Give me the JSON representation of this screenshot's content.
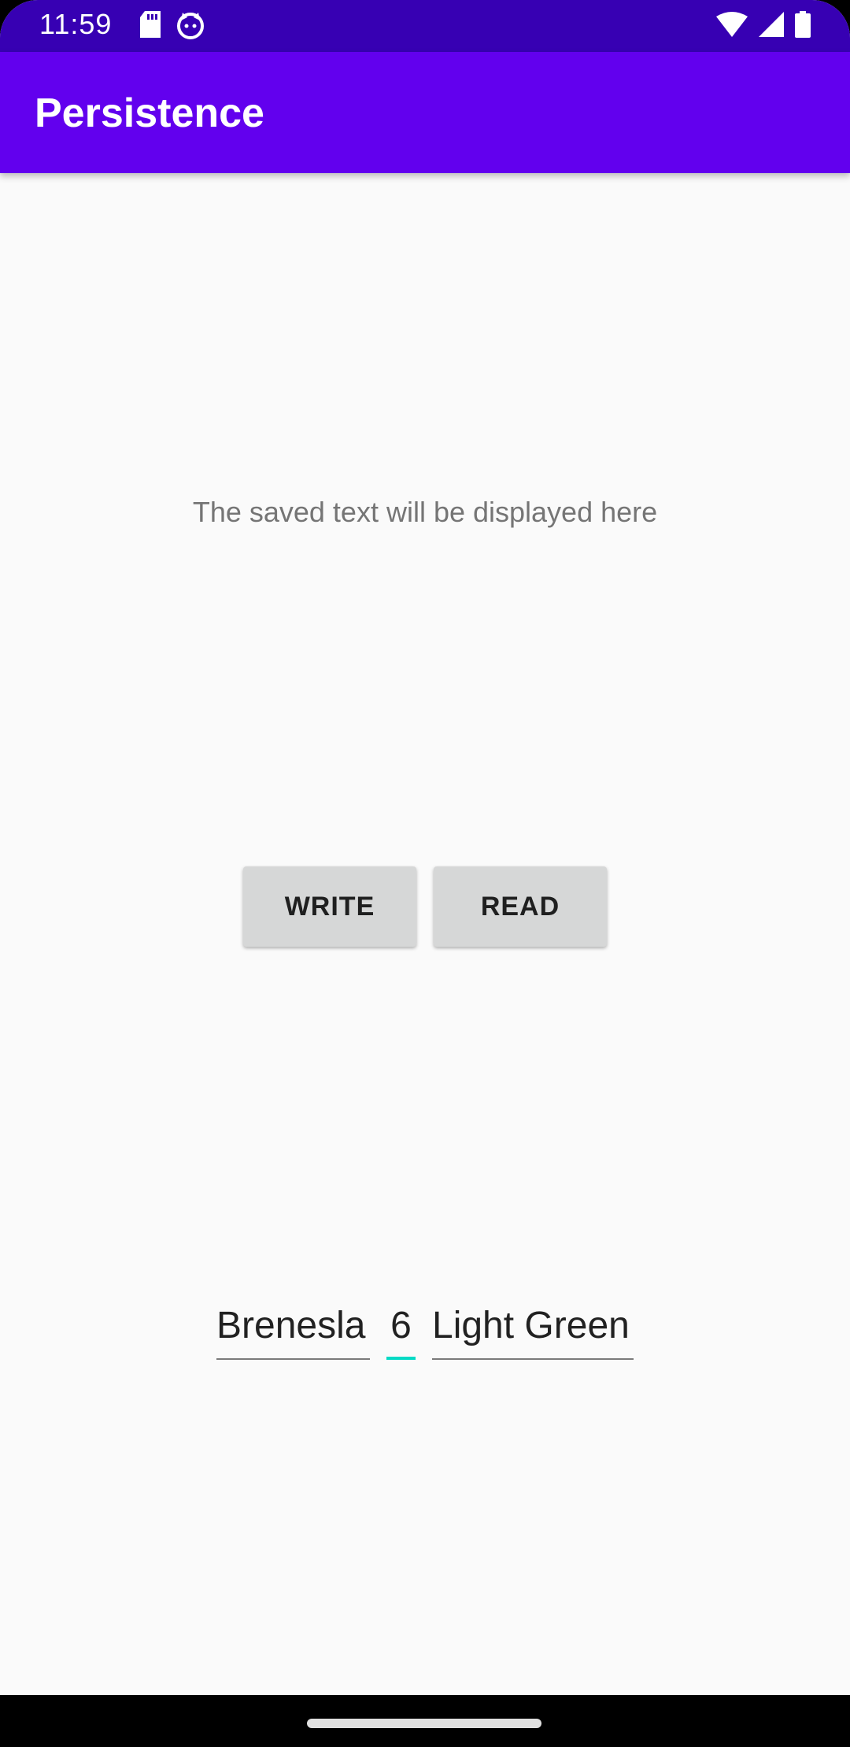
{
  "status_bar": {
    "time": "11:59",
    "icons_left": [
      "sd-card-icon",
      "cat-face-icon"
    ],
    "icons_right": [
      "wifi-icon",
      "cellular-signal-icon",
      "battery-icon"
    ],
    "background": "#3700b3"
  },
  "app_bar": {
    "title": "Persistence",
    "background": "#6200ee"
  },
  "main": {
    "saved_text": "The saved text will be displayed here",
    "buttons": {
      "write_label": "WRITE",
      "read_label": "READ"
    },
    "fields": {
      "name_value": "Brenesla",
      "number_value": "6",
      "color_value": "Light Green"
    },
    "focus_accent": "#03dac5"
  }
}
